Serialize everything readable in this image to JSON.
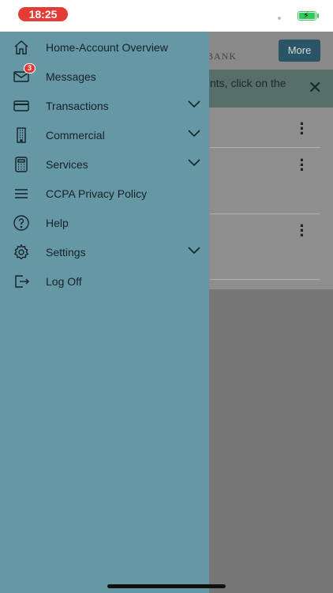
{
  "status": {
    "time": "18:25"
  },
  "app": {
    "logo_text": "BANK",
    "more_label": "More",
    "banner_text": "nts, click on the",
    "close_glyph": "✕"
  },
  "drawer": {
    "items": [
      {
        "label": "Home-Account Overview",
        "icon": "home-icon",
        "expandable": false
      },
      {
        "label": "Messages",
        "icon": "mail-icon",
        "badge": "3",
        "expandable": false
      },
      {
        "label": "Transactions",
        "icon": "card-icon",
        "expandable": true
      },
      {
        "label": "Commercial",
        "icon": "building-icon",
        "expandable": true
      },
      {
        "label": "Services",
        "icon": "calculator-icon",
        "expandable": true
      },
      {
        "label": "CCPA Privacy Policy",
        "icon": "menu-lines-icon",
        "expandable": false
      },
      {
        "label": "Help",
        "icon": "help-icon",
        "expandable": false
      },
      {
        "label": "Settings",
        "icon": "gear-icon",
        "expandable": true
      },
      {
        "label": "Log Off",
        "icon": "logout-icon",
        "expandable": false
      }
    ]
  },
  "colors": {
    "drawer_bg": "#6697a5",
    "time_pill": "#e33b35",
    "more_button": "#2a5566",
    "badge": "#e23a32"
  }
}
